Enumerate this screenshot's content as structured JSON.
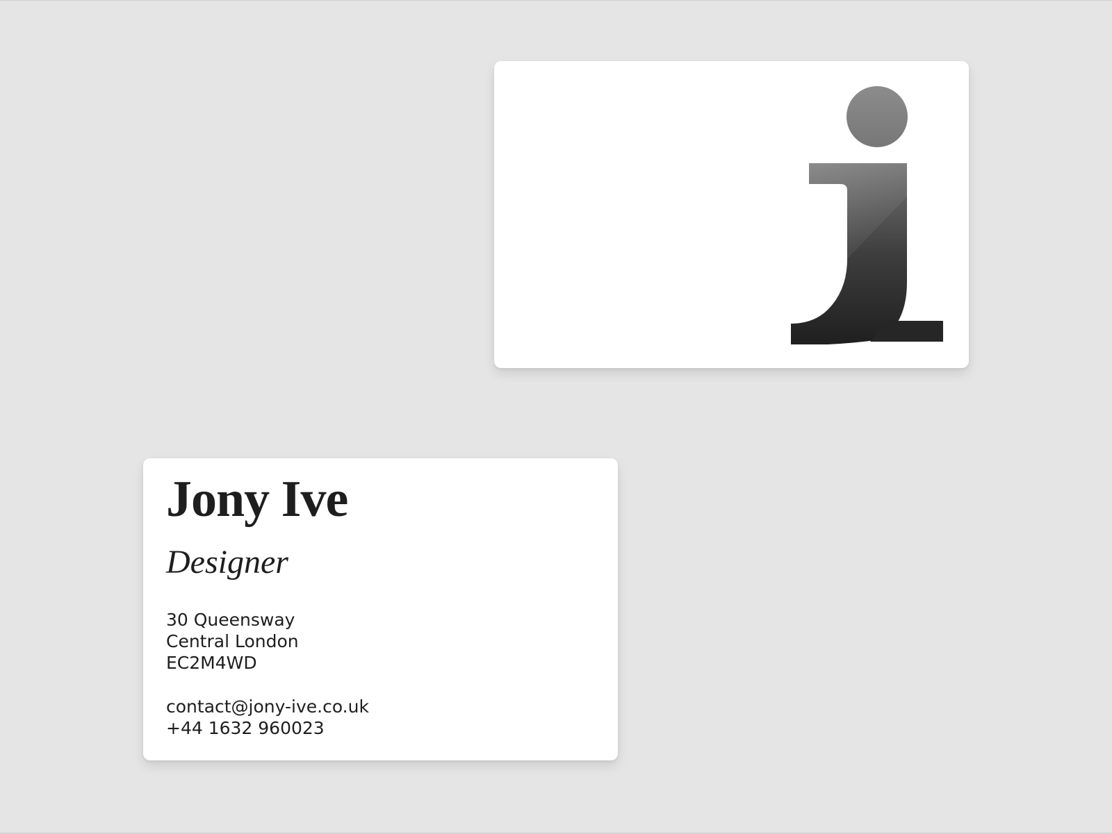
{
  "card_front": {
    "name": "Jony Ive",
    "title": "Designer",
    "address": [
      "30 Queensway",
      "Central London",
      "EC2M4WD"
    ],
    "email": "contact@jony-ive.co.uk",
    "phone": "+44 1632 960023"
  },
  "card_back": {
    "logo_letter": "j",
    "logo_icon": "letter-j-logo-icon"
  },
  "colors": {
    "background": "#e5e5e5",
    "card": "#ffffff",
    "text": "#1e1e1e",
    "logo_dot": "#858585",
    "logo_top": "#6f6f6f",
    "logo_bottom": "#1f1f1f"
  }
}
